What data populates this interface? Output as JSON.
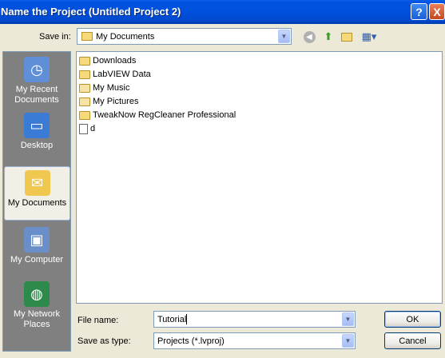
{
  "window": {
    "title": "Name the Project (Untitled Project 2)",
    "help_glyph": "?",
    "close_glyph": "X"
  },
  "save_in": {
    "label": "Save in:",
    "value": "My Documents",
    "icons": [
      "back-icon",
      "up-folder-icon",
      "new-folder-icon",
      "views-menu-icon"
    ]
  },
  "places": [
    {
      "name": "recent",
      "label_lines": [
        "My Recent",
        "Documents"
      ],
      "icon": "clock-icon"
    },
    {
      "name": "desktop",
      "label_lines": [
        "Desktop"
      ],
      "icon": "desktop-icon"
    },
    {
      "name": "mydocs",
      "label_lines": [
        "My Documents"
      ],
      "icon": "folder-open-icon",
      "selected": true
    },
    {
      "name": "computer",
      "label_lines": [
        "My Computer"
      ],
      "icon": "computer-icon"
    },
    {
      "name": "network",
      "label_lines": [
        "My Network",
        "Places"
      ],
      "icon": "network-globe-icon"
    }
  ],
  "files": [
    {
      "name": "Downloads",
      "type": "folder"
    },
    {
      "name": "LabVIEW Data",
      "type": "folder"
    },
    {
      "name": "My Music",
      "type": "folder-music"
    },
    {
      "name": "My Pictures",
      "type": "folder-pictures"
    },
    {
      "name": "TweakNow RegCleaner Professional",
      "type": "folder"
    },
    {
      "name": "d",
      "type": "document"
    }
  ],
  "filename": {
    "label": "File name:",
    "value": "Tutorial"
  },
  "filetype": {
    "label": "Save as type:",
    "value": "Projects (*.lvproj)"
  },
  "buttons": {
    "ok": "OK",
    "cancel": "Cancel"
  },
  "colors": {
    "titlebar": "#0050dc",
    "dialog_bg": "#ece9d8",
    "places_bg": "#808080"
  }
}
